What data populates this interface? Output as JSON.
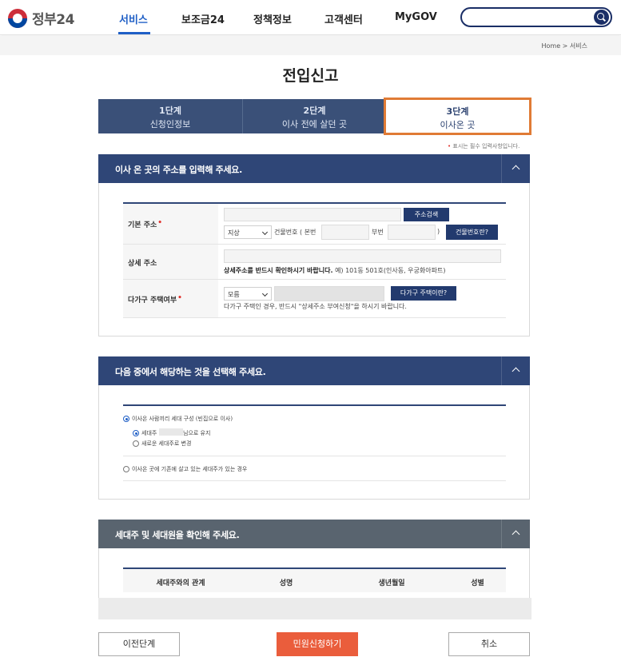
{
  "header": {
    "logo_text": "정부24",
    "nav": [
      "서비스",
      "보조금24",
      "정책정보",
      "고객센터",
      "MyGOV"
    ],
    "active_nav": "서비스"
  },
  "breadcrumb": "Home > 서비스",
  "page_title": "전입신고",
  "steps": [
    {
      "num": "1단계",
      "label": "신청인정보"
    },
    {
      "num": "2단계",
      "label": "이사 전에 살던 곳"
    },
    {
      "num": "3단계",
      "label": "이사온 곳"
    }
  ],
  "required_note": "표시는 필수 입력사항입니다.",
  "section1": {
    "title": "이사 온 곳의 주소를 입력해 주세요.",
    "basic_address_label": "기본 주소",
    "search_button": "주소검색",
    "land_type_select": "지상",
    "building_number_text": "건물번호 ( 본번",
    "sub_number_text": "부번",
    "close_paren": ")",
    "building_help_button": "건물번호란?",
    "detail_address_label": "상세 주소",
    "detail_note_bold": "상세주소를 반드시 확인하시기 바랍니다.",
    "detail_note_example": "예) 101동 501호(인사동, 우궁화아파트)",
    "multi_house_label": "다가구 주택여부",
    "multi_house_select": "모름",
    "multi_house_button": "다가구 주택이란?",
    "multi_house_note": "다가구 주택인 경우, 반드시 \"상세주소 부여신청\"을 하시기 바랍니다."
  },
  "section2": {
    "title": "다음 중에서 해당하는 것을 선택해 주세요.",
    "option1": "이사온 사람끼리 세대 구성 (빈집으로 이사)",
    "sub1_prefix": "세대주",
    "sub1_suffix": "님으로 유지",
    "sub2": "새로운 세대주로 변경",
    "option2": "이사온 곳에 기존에 살고 있는 세대주가 있는 경우"
  },
  "section3": {
    "title": "세대주 및 세대원을 확인해 주세요.",
    "columns": [
      "세대주와의 관계",
      "성명",
      "생년월일",
      "성별"
    ]
  },
  "buttons": {
    "prev": "이전단계",
    "submit": "민원신청하기",
    "cancel": "취소"
  },
  "colors": {
    "navy": "#2f4677",
    "accent_orange": "#e07b35",
    "submit_red": "#ea5d3c",
    "nav_blue": "#1f5fc6"
  }
}
